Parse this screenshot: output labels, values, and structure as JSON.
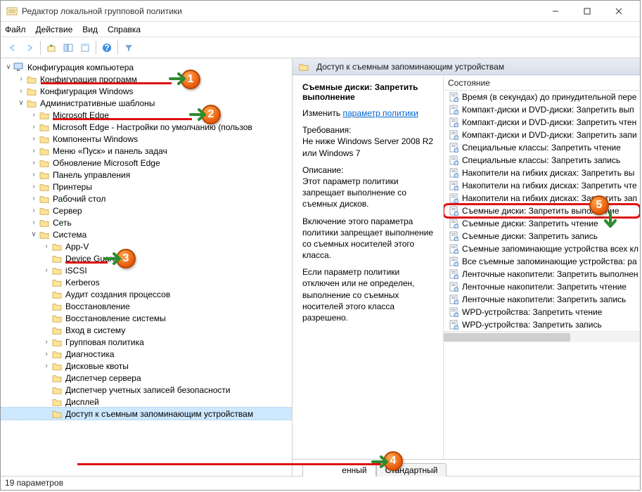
{
  "window": {
    "title": "Редактор локальной групповой политики"
  },
  "menu": {
    "file": "Файл",
    "action": "Действие",
    "view": "Вид",
    "help": "Справка"
  },
  "tree": {
    "root": "Конфигурация компьютера",
    "c1": "Конфигурация программ",
    "c2": "Конфигурация Windows",
    "c3": "Административные шаблоны",
    "a1": "Microsoft Edge",
    "a2": "Microsoft Edge - Настройки по умолчанию (пользов",
    "a3": "Компоненты Windows",
    "a4": "Меню «Пуск» и панель задач",
    "a5": "Обновление Microsoft Edge",
    "a6": "Панель управления",
    "a7": "Принтеры",
    "a8": "Рабочий стол",
    "a9": "Сервер",
    "a10": "Сеть",
    "a11": "Система",
    "s1": "App-V",
    "s2": "Device Guard",
    "s3": "iSCSI",
    "s4": "Kerberos",
    "s5": "Аудит создания процессов",
    "s6": "Восстановление",
    "s7": "Восстановление системы",
    "s8": "Вход в систему",
    "s9": "Групповая политика",
    "s10": "Диагностика",
    "s11": "Дисковые квоты",
    "s12": "Диспетчер сервера",
    "s13": "Диспетчер учетных записей безопасности",
    "s14": "Дисплей",
    "s15": "Доступ к съемным запоминающим устройствам"
  },
  "right": {
    "header": "Доступ к съемным запоминающим устройствам",
    "policy_title": "Съемные диски: Запретить выполнение",
    "edit_prefix": "Изменить ",
    "edit_link": "параметр политики",
    "req_label": "Требования:",
    "req_text": "Не ниже Windows Server 2008 R2 или Windows 7",
    "desc_label": "Описание:",
    "desc_p1": "Этот параметр политики запрещает выполнение со съемных дисков.",
    "desc_p2": "Включение этого параметра политики запрещает выполнение со съемных носителей этого класса.",
    "desc_p3": "Если параметр политики отключен или не определен, выполнение со съемных носителей этого класса разрешено.",
    "col1": "Состояние",
    "items": [
      "Время (в секундах) до принудительной пере",
      "Компакт-диски и DVD-диски: Запретить вып",
      "Компакт-диски и DVD-диски: Запретить чтен",
      "Компакт-диски и DVD-диски: Запретить запи",
      "Специальные классы: Запретить чтение",
      "Специальные классы: Запретить запись",
      "Накопители на гибких дисках: Запретить вы",
      "Накопители на гибких дисках: Запретить чте",
      "Накопители на гибких дисках: Запретить зап",
      "Съемные диски: Запретить выполнение",
      "Съемные диски: Запретить чтение",
      "Съемные диски: Запретить запись",
      "Съемные запоминающие устройства всех кл",
      "Все съемные запоминающие устройства: ра",
      "Ленточные накопители: Запретить выполнен",
      "Ленточные накопители: Запретить чтение",
      "Ленточные накопители: Запретить запись",
      "WPD-устройства: Запретить чтение",
      "WPD-устройства: Запретить запись"
    ],
    "tab_ext": "енный",
    "tab_std": "Стандартный"
  },
  "status": "19 параметров"
}
